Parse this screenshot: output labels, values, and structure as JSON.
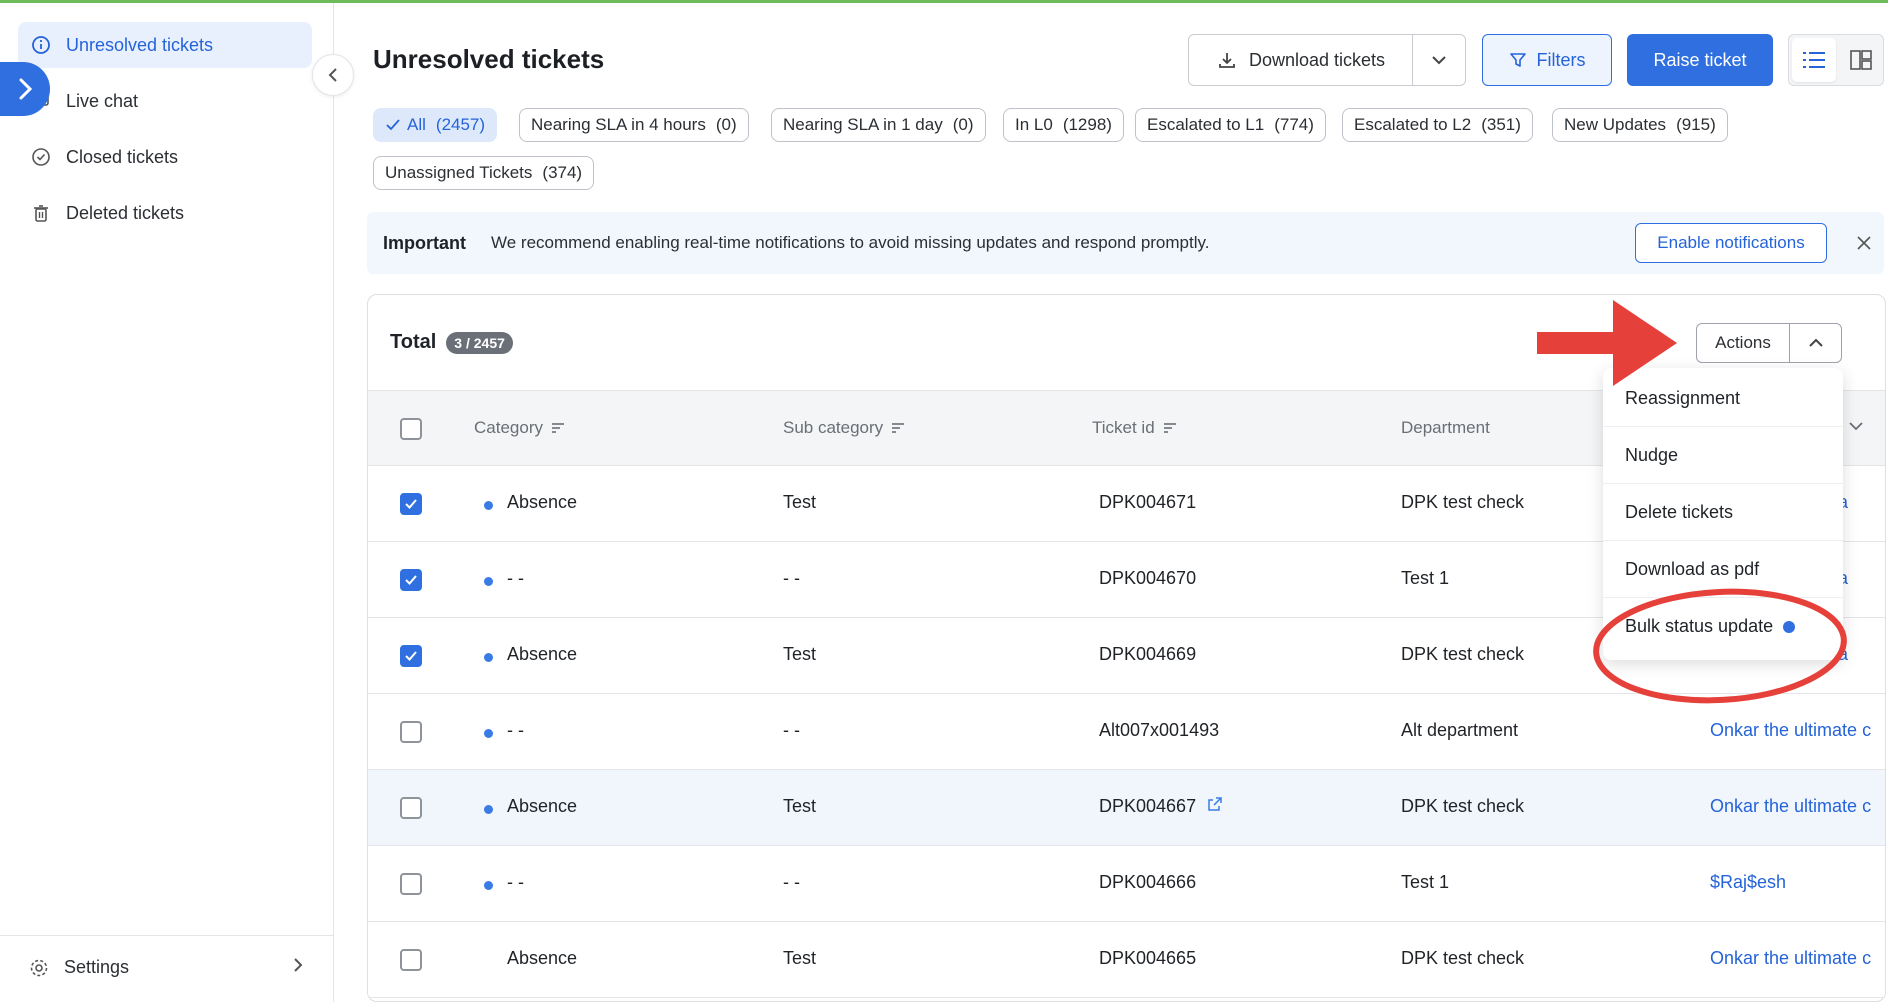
{
  "sidebar": {
    "items": [
      {
        "label": "Unresolved tickets"
      },
      {
        "label": "Live chat"
      },
      {
        "label": "Closed tickets"
      },
      {
        "label": "Deleted tickets"
      }
    ],
    "settings_label": "Settings"
  },
  "header": {
    "title": "Unresolved tickets",
    "download_label": "Download tickets",
    "filters_label": "Filters",
    "raise_label": "Raise ticket"
  },
  "filters": [
    {
      "label": "All",
      "count": "(2457)"
    },
    {
      "label": "Nearing SLA in 4 hours",
      "count": "(0)"
    },
    {
      "label": "Nearing SLA in 1 day",
      "count": "(0)"
    },
    {
      "label": "In L0",
      "count": "(1298)"
    },
    {
      "label": "Escalated to L1",
      "count": "(774)"
    },
    {
      "label": "Escalated to L2",
      "count": "(351)"
    },
    {
      "label": "New Updates",
      "count": "(915)"
    },
    {
      "label": "Unassigned Tickets",
      "count": "(374)"
    }
  ],
  "banner": {
    "title": "Important",
    "message": "We recommend enabling real-time notifications to avoid missing updates and respond promptly.",
    "button": "Enable notifications"
  },
  "table": {
    "total_label": "Total",
    "total_badge": "3 / 2457",
    "actions_label": "Actions",
    "columns": [
      "Category",
      "Sub category",
      "Ticket id",
      "Department"
    ],
    "rows": [
      {
        "checked": true,
        "category": "Absence",
        "sub": "Test",
        "id": "DPK004671",
        "dept": "DPK test check",
        "assignee": "a"
      },
      {
        "checked": true,
        "category": "- -",
        "sub": "- -",
        "id": "DPK004670",
        "dept": "Test 1",
        "assignee": "a"
      },
      {
        "checked": true,
        "category": "Absence",
        "sub": "Test",
        "id": "DPK004669",
        "dept": "DPK test check",
        "assignee": "a"
      },
      {
        "checked": false,
        "category": "- -",
        "sub": "- -",
        "id": "Alt007x001493",
        "dept": "Alt department",
        "assignee": "Onkar the ultimate c"
      },
      {
        "checked": false,
        "category": "Absence",
        "sub": "Test",
        "id": "DPK004667",
        "dept": "DPK test check",
        "assignee": "Onkar the ultimate c"
      },
      {
        "checked": false,
        "category": "- -",
        "sub": "- -",
        "id": "DPK004666",
        "dept": "Test 1",
        "assignee": "$Raj$esh"
      },
      {
        "checked": false,
        "category": "Absence",
        "sub": "Test",
        "id": "DPK004665",
        "dept": "DPK test check",
        "assignee": "Onkar the ultimate c"
      }
    ]
  },
  "actions_menu": [
    "Reassignment",
    "Nudge",
    "Delete tickets",
    "Download as pdf",
    "Bulk status update"
  ],
  "colors": {
    "accent": "#2f6fe0",
    "annotation_red": "#e5403a"
  }
}
